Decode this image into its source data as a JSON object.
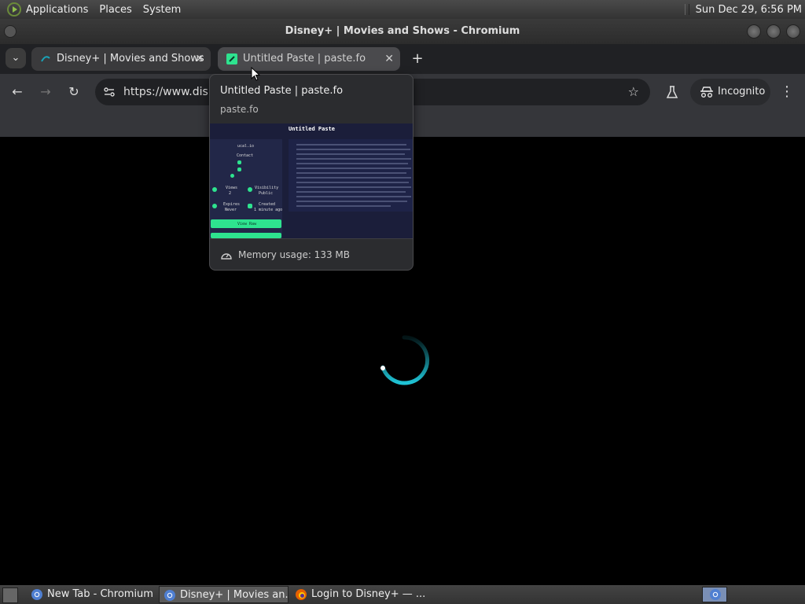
{
  "system_panel": {
    "menus": [
      "Applications",
      "Places",
      "System"
    ],
    "clock": "Sun Dec 29,  6:56 PM"
  },
  "window": {
    "title": "Disney+ | Movies and Shows - Chromium"
  },
  "tabs": [
    {
      "title": "Disney+ | Movies and Shows",
      "close": "✕"
    },
    {
      "title": "Untitled Paste | paste.fo",
      "close": "✕"
    }
  ],
  "new_tab_label": "+",
  "tab_search_label": "⌄",
  "toolbar": {
    "back": "←",
    "forward": "→",
    "reload": "↻",
    "url": "https://www.disn",
    "star": "☆",
    "incognito_label": "Incognito",
    "menu": "⋮"
  },
  "hover_card": {
    "title": "Untitled Paste | paste.fo",
    "domain": "paste.fo",
    "memory": "Memory usage: 133 MB",
    "thumbnail": {
      "heading": "Untitled Paste",
      "side_label_1": "ucal.io",
      "contact": "Contact",
      "views_label": "Views",
      "views_value": "2",
      "visibility_label": "Visibility",
      "visibility_value": "Public",
      "expires_label": "Expires",
      "expires_value": "Never",
      "created_label": "Created",
      "created_value": "1 minute ago",
      "button_label": "View Raw"
    }
  },
  "taskbar": {
    "tasks": [
      {
        "label": "New Tab - Chromium",
        "icon": "chromium-icon"
      },
      {
        "label": "Disney+ | Movies an...",
        "icon": "chromium-icon"
      },
      {
        "label": "Login to Disney+ — ...",
        "icon": "firefox-icon"
      }
    ]
  },
  "colors": {
    "spinner": "#1fc4d6",
    "thumbnail_accent": "#2ee38f",
    "tab_strip": "#202124",
    "toolbar": "#35363a"
  }
}
